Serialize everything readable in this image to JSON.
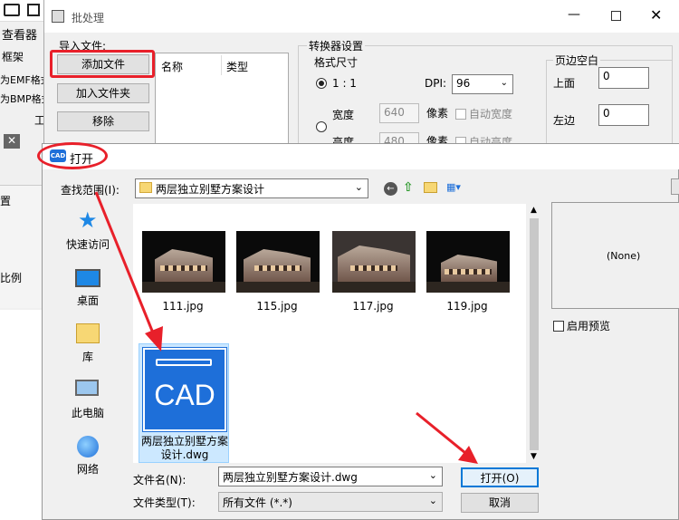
{
  "bg": {
    "left_panel_items": [
      "查看器",
      "框架",
      "为EMF格式",
      "为BMP格式",
      "工"
    ],
    "left_side_items": [
      "置",
      "",
      "",
      "比例",
      ""
    ]
  },
  "batch": {
    "title": "批处理",
    "import_group": "导入文件:",
    "add_file": "添加文件",
    "add_folder": "加入文件夹",
    "remove": "移除",
    "col_name": "名称",
    "col_type": "类型",
    "converter_group": "转换器设置",
    "format_size": "格式尺寸",
    "ratio": "1 : 1",
    "dpi_label": "DPI:",
    "dpi_value": "96",
    "width_label": "宽度",
    "width_value": "640",
    "height_label": "高度",
    "height_value": "480",
    "pixel1": "像素",
    "pixel2": "像素",
    "auto_width": "自动宽度",
    "auto_height": "自动高度",
    "margin_group": "页边空白",
    "top_label": "上面",
    "top_value": "0",
    "left_label": "左边",
    "left_value": "0"
  },
  "open": {
    "title": "打开",
    "lookin_label": "查找范围(I):",
    "lookin_value": "两层独立别墅方案设计",
    "nav": [
      "快速访问",
      "桌面",
      "库",
      "此电脑",
      "网络"
    ],
    "files": [
      "111.jpg",
      "115.jpg",
      "117.jpg",
      "119.jpg"
    ],
    "selected_file": "两层独立别墅方案设计.dwg",
    "cad_text": "CAD",
    "preview_none": "(None)",
    "enable_preview": "启用预览",
    "filename_label": "文件名(N):",
    "filename_value": "两层独立别墅方案设计.dwg",
    "filetype_label": "文件类型(T):",
    "filetype_value": "所有文件 (*.*)",
    "open_btn": "打开(O)",
    "cancel_btn": "取消"
  },
  "colors": {
    "accent": "#1e6fd9",
    "annotation": "#e8202a",
    "selection": "#cce8ff"
  }
}
